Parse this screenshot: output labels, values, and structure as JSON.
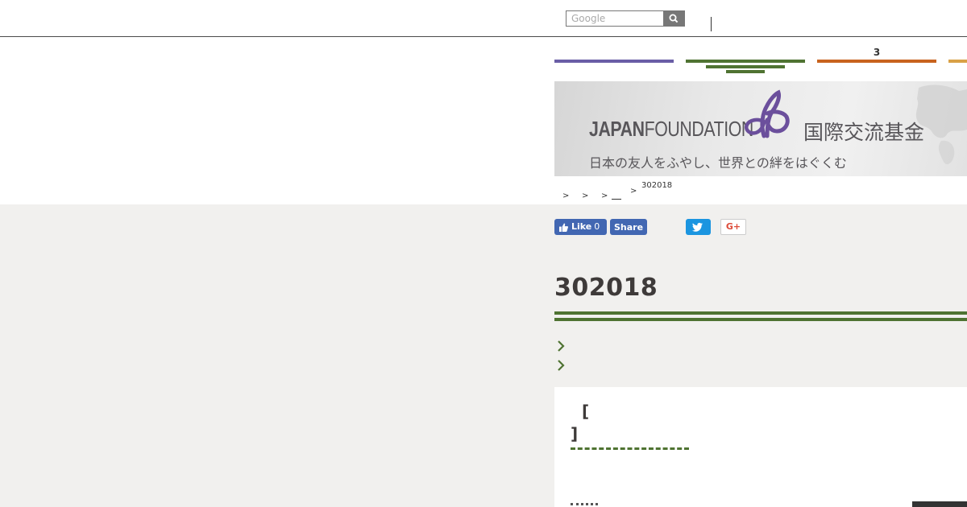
{
  "search": {
    "placeholder": "Google"
  },
  "nav": {
    "tabs": [
      {
        "label": "",
        "color": "#6a5ea6"
      },
      {
        "label": "",
        "color": "#4f7332"
      },
      {
        "label": "3",
        "color": "#c8631e"
      },
      {
        "label": "",
        "color": "#d9a146"
      }
    ]
  },
  "banner": {
    "logo_en_bold": "JAPAN",
    "logo_en_light": "FOUNDATION",
    "logo_jp": "国際交流基金",
    "tagline": "日本の友人をふやし、世界との絆をはぐくむ",
    "mark_color": "#6b4f9c"
  },
  "breadcrumb": {
    "separators": [
      ">",
      ">",
      ">",
      ">"
    ],
    "current": "302018"
  },
  "social": {
    "like_label": "Like",
    "like_count": "0",
    "share_label": "Share",
    "gplus_label": "G+"
  },
  "page": {
    "title": "302018",
    "accent_color": "#4f7332"
  },
  "card": {
    "bracket_open": "[",
    "bracket_close": "]"
  }
}
